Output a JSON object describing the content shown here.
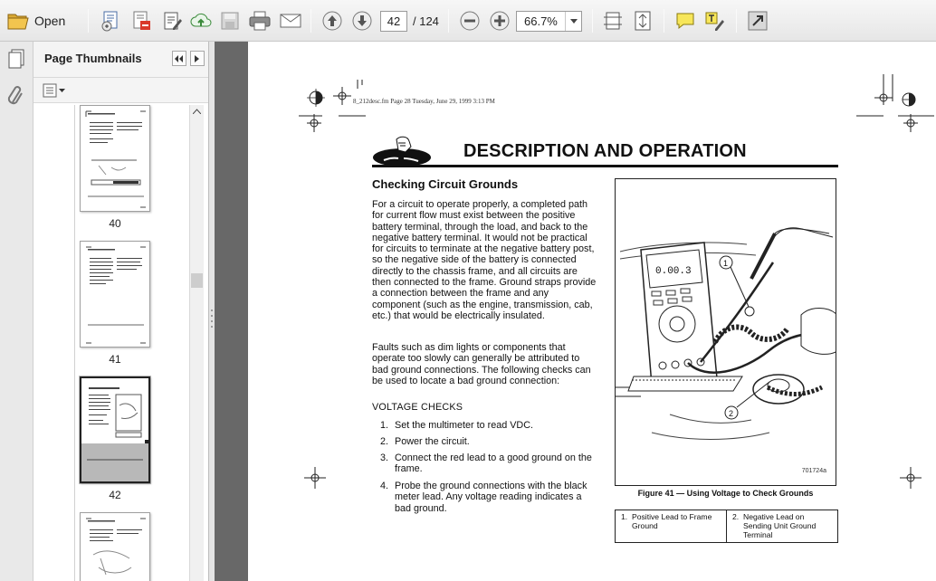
{
  "toolbar": {
    "open_label": "Open",
    "current_page": "42",
    "total_pages": "/ 124",
    "zoom": "66.7%"
  },
  "icons": [
    "open-folder-icon",
    "create-pdf-icon",
    "edit-pdf-icon",
    "sign-icon",
    "upload-icon",
    "save-icon",
    "print-icon",
    "email-icon",
    "previous-page-icon",
    "next-page-icon",
    "zoom-out-icon",
    "zoom-in-icon",
    "fit-width-icon",
    "fit-page-icon",
    "comment-icon",
    "highlight-text-icon",
    "expand-icon"
  ],
  "sidebar": {
    "title": "Page Thumbnails",
    "thumbnails": [
      {
        "label": "40"
      },
      {
        "label": "41"
      },
      {
        "label": "42",
        "selected": true
      },
      {
        "label": ""
      }
    ]
  },
  "document": {
    "header_line": "8_212desc.fm  Page 28  Tuesday, June 29, 1999  3:13 PM",
    "title": "DESCRIPTION AND OPERATION",
    "section_title": "Checking Circuit Grounds",
    "para1": "For a circuit to operate properly, a completed path for current flow must exist between the positive battery terminal, through the load, and back to the negative battery terminal. It would not be practical for circuits to terminate at the negative battery post, so the negative side of the battery is connected directly to the chassis frame, and all circuits are then connected to the frame. Ground straps provide a connection between the frame and any component (such as the engine, transmission, cab, etc.) that would be electrically insulated.",
    "para2": "Faults such as dim lights or components that operate too slowly can generally be attributed to bad ground connections. The following checks can be used to locate a bad ground connection:",
    "sub_heading": "VOLTAGE CHECKS",
    "steps": [
      {
        "num": "1.",
        "text": "Set the multimeter to read VDC."
      },
      {
        "num": "2.",
        "text": "Power the circuit."
      },
      {
        "num": "3.",
        "text": "Connect the red lead to a good ground on the frame."
      },
      {
        "num": "4.",
        "text": "Probe the ground connections with the black meter lead. Any voltage reading indicates a bad ground."
      }
    ],
    "figure": {
      "display": "0.00.3",
      "callout_1": "1",
      "callout_2": "2",
      "code": "701724a",
      "caption": "Figure 41 — Using Voltage to Check Grounds"
    },
    "legend": [
      {
        "num": "1.",
        "text": "Positive Lead to Frame Ground"
      },
      {
        "num": "2.",
        "text": "Negative Lead on Sending Unit Ground Terminal"
      }
    ]
  }
}
